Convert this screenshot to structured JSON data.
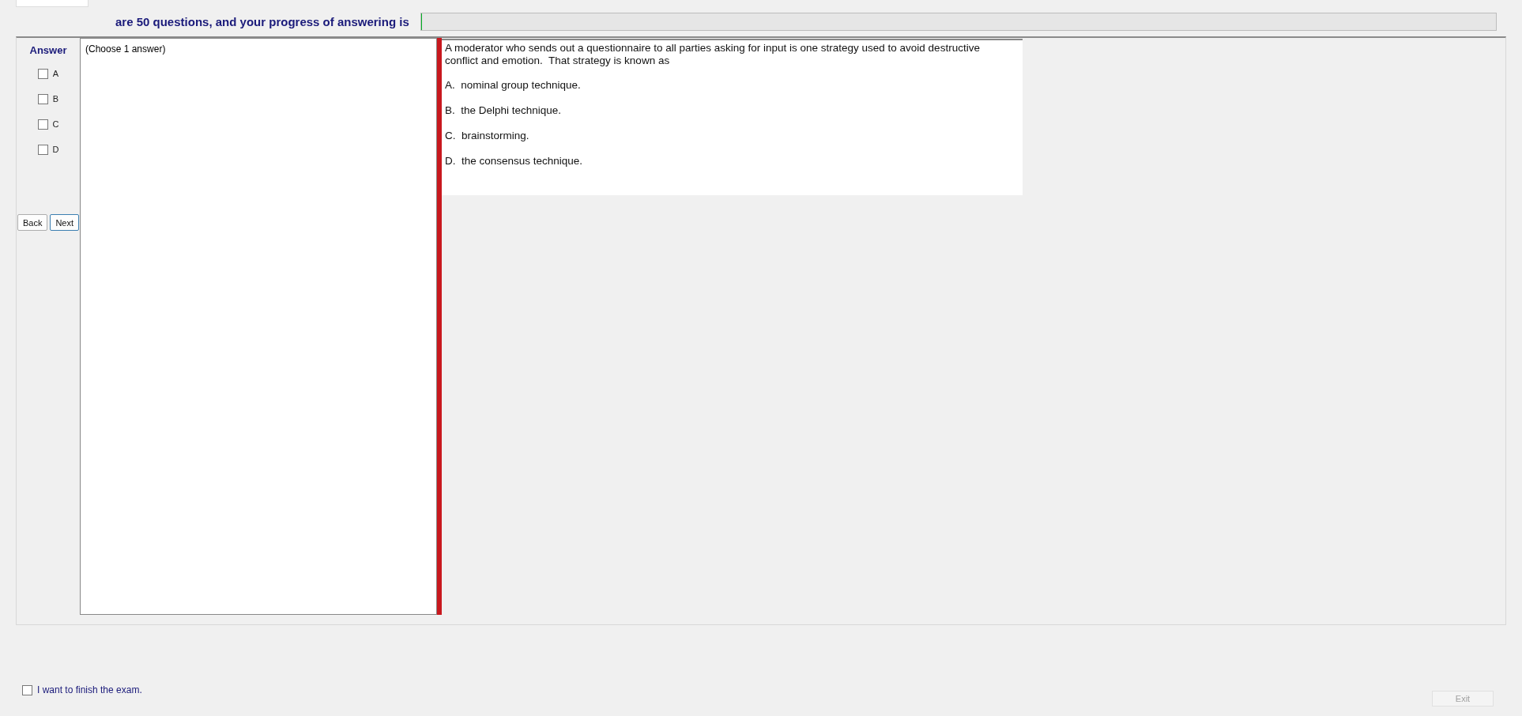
{
  "header": {
    "text": "are 50 questions, and your progress of answering is",
    "progress": {
      "level": 0
    }
  },
  "answer_panel": {
    "title": "Answer",
    "options": [
      {
        "label": "A",
        "checked": false
      },
      {
        "label": "B",
        "checked": false
      },
      {
        "label": "C",
        "checked": false
      },
      {
        "label": "D",
        "checked": false
      }
    ],
    "buttons": [
      {
        "label": "Back",
        "focused": false
      },
      {
        "label": "Next",
        "focused": true
      }
    ]
  },
  "instruction": "(Choose 1 answer)",
  "question": {
    "text": "A moderator who sends out a questionnaire to all parties asking for input is one strategy used to avoid destructive conflict and emotion.  That strategy is known as",
    "choices": [
      "A.  nominal group technique.",
      "B.  the Delphi technique.",
      "C.  brainstorming.",
      "D.  the consensus technique."
    ]
  },
  "finish": {
    "label": "I want to finish the exam.",
    "checked": false
  },
  "exit_button": {
    "label": "Exit",
    "disabled": true
  }
}
